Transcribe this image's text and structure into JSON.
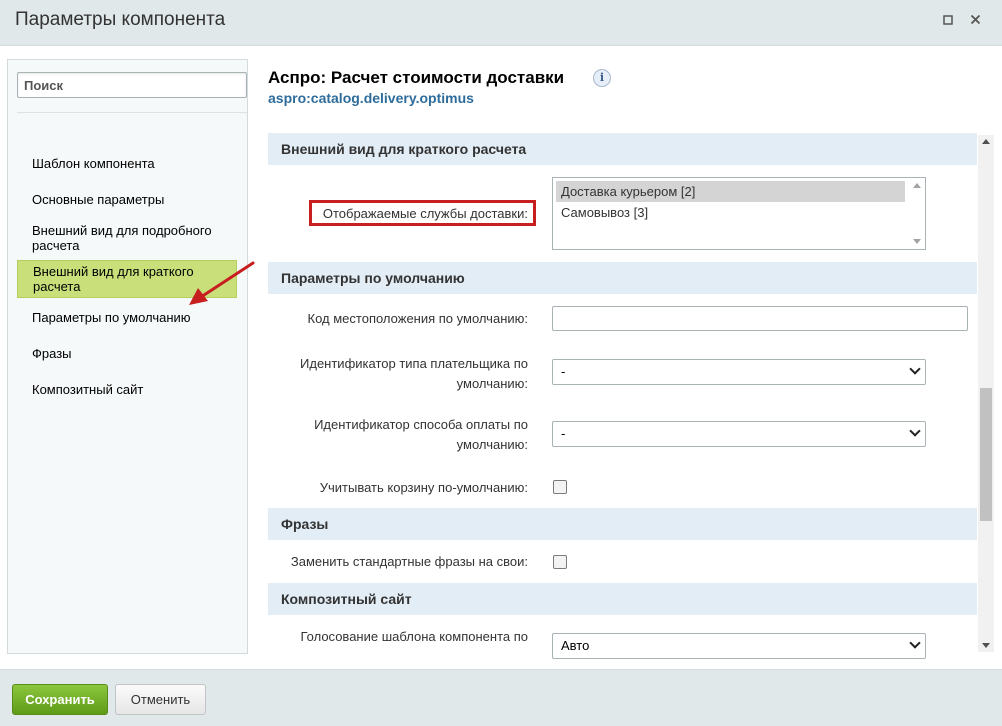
{
  "window": {
    "title": "Параметры компонента"
  },
  "sidebar": {
    "search_placeholder": "Поиск",
    "items": [
      {
        "label": "Шаблон компонента"
      },
      {
        "label": "Основные параметры"
      },
      {
        "label": "Внешний вид для подробного расчета"
      },
      {
        "label": "Внешний вид для краткого расчета"
      },
      {
        "label": "Параметры по умолчанию"
      },
      {
        "label": "Фразы"
      },
      {
        "label": "Композитный сайт"
      }
    ],
    "active_item": "Внешний вид для краткого расчета"
  },
  "main": {
    "title": "Аспро: Расчет стоимости доставки",
    "subtitle": "aspro:catalog.delivery.optimus",
    "sections": [
      {
        "header": "Внешний вид для краткого расчета",
        "fields": [
          {
            "label": "Отображаемые службы доставки:",
            "type": "multiselect",
            "options": [
              "Доставка курьером [2]",
              "Самовывоз [3]"
            ],
            "selected": "Доставка курьером [2]"
          }
        ]
      },
      {
        "header": "Параметры по умолчанию",
        "fields": [
          {
            "label": "Код местоположения по умолчанию:",
            "type": "text",
            "value": ""
          },
          {
            "label": "Идентификатор типа плательщика по умолчанию:",
            "type": "select",
            "value": "-"
          },
          {
            "label": "Идентификатор способа оплаты по умолчанию:",
            "type": "select",
            "value": "-"
          },
          {
            "label": "Учитывать корзину по-умолчанию:",
            "type": "checkbox",
            "checked": false
          }
        ]
      },
      {
        "header": "Фразы",
        "fields": [
          {
            "label": "Заменить стандартные фразы на свои:",
            "type": "checkbox",
            "checked": false
          }
        ]
      },
      {
        "header": "Композитный сайт",
        "fields": [
          {
            "label": "Голосование шаблона компонента по",
            "type": "select",
            "value": "Авто"
          }
        ]
      }
    ]
  },
  "footer": {
    "save_label": "Сохранить",
    "cancel_label": "Отменить"
  },
  "colors": {
    "save_button": "#6aa821",
    "highlight_box": "#c71f1f",
    "active_sidebar_item": "#c9e07a",
    "section_header": "#e3edf5",
    "annotation_arrow": "#c71f1f"
  },
  "icons": {
    "maximize": "maximize-icon",
    "close": "close-icon",
    "info": "info-icon"
  }
}
